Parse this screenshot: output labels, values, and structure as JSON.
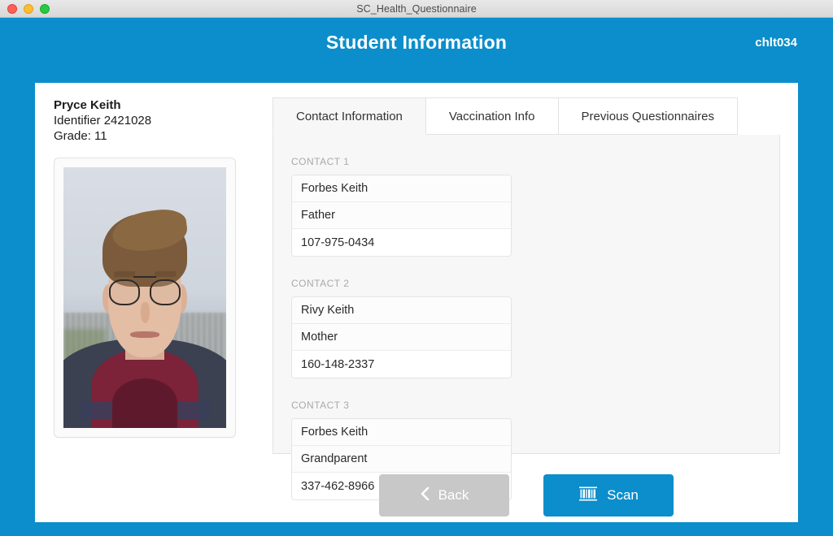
{
  "window": {
    "title": "SC_Health_Questionnaire",
    "controls": [
      "close",
      "minimize",
      "maximize"
    ]
  },
  "header": {
    "title": "Student Information",
    "code": "chlt034",
    "accent_color": "#0b8ecb"
  },
  "student": {
    "name": "Pryce Keith",
    "identifier_line": "Identifier 2421028",
    "grade_line": "Grade: 11",
    "photo_alt": "student-portrait"
  },
  "tabs": [
    {
      "label": "Contact Information",
      "active": true
    },
    {
      "label": "Vaccination Info",
      "active": false
    },
    {
      "label": "Previous Questionnaires",
      "active": false
    }
  ],
  "contacts": [
    {
      "label": "CONTACT 1",
      "name": "Forbes Keith",
      "relation": "Father",
      "phone": "107-975-0434"
    },
    {
      "label": "CONTACT 2",
      "name": "Rivy Keith",
      "relation": "Mother",
      "phone": "160-148-2337"
    },
    {
      "label": "CONTACT 3",
      "name": "Forbes Keith",
      "relation": "Grandparent",
      "phone": "337-462-8966"
    }
  ],
  "footer": {
    "back_label": "Back",
    "back_icon": "chevron-left-icon",
    "back_color": "#c8c8c8",
    "scan_label": "Scan",
    "scan_icon": "barcode-icon",
    "scan_color": "#0b8ecb"
  }
}
